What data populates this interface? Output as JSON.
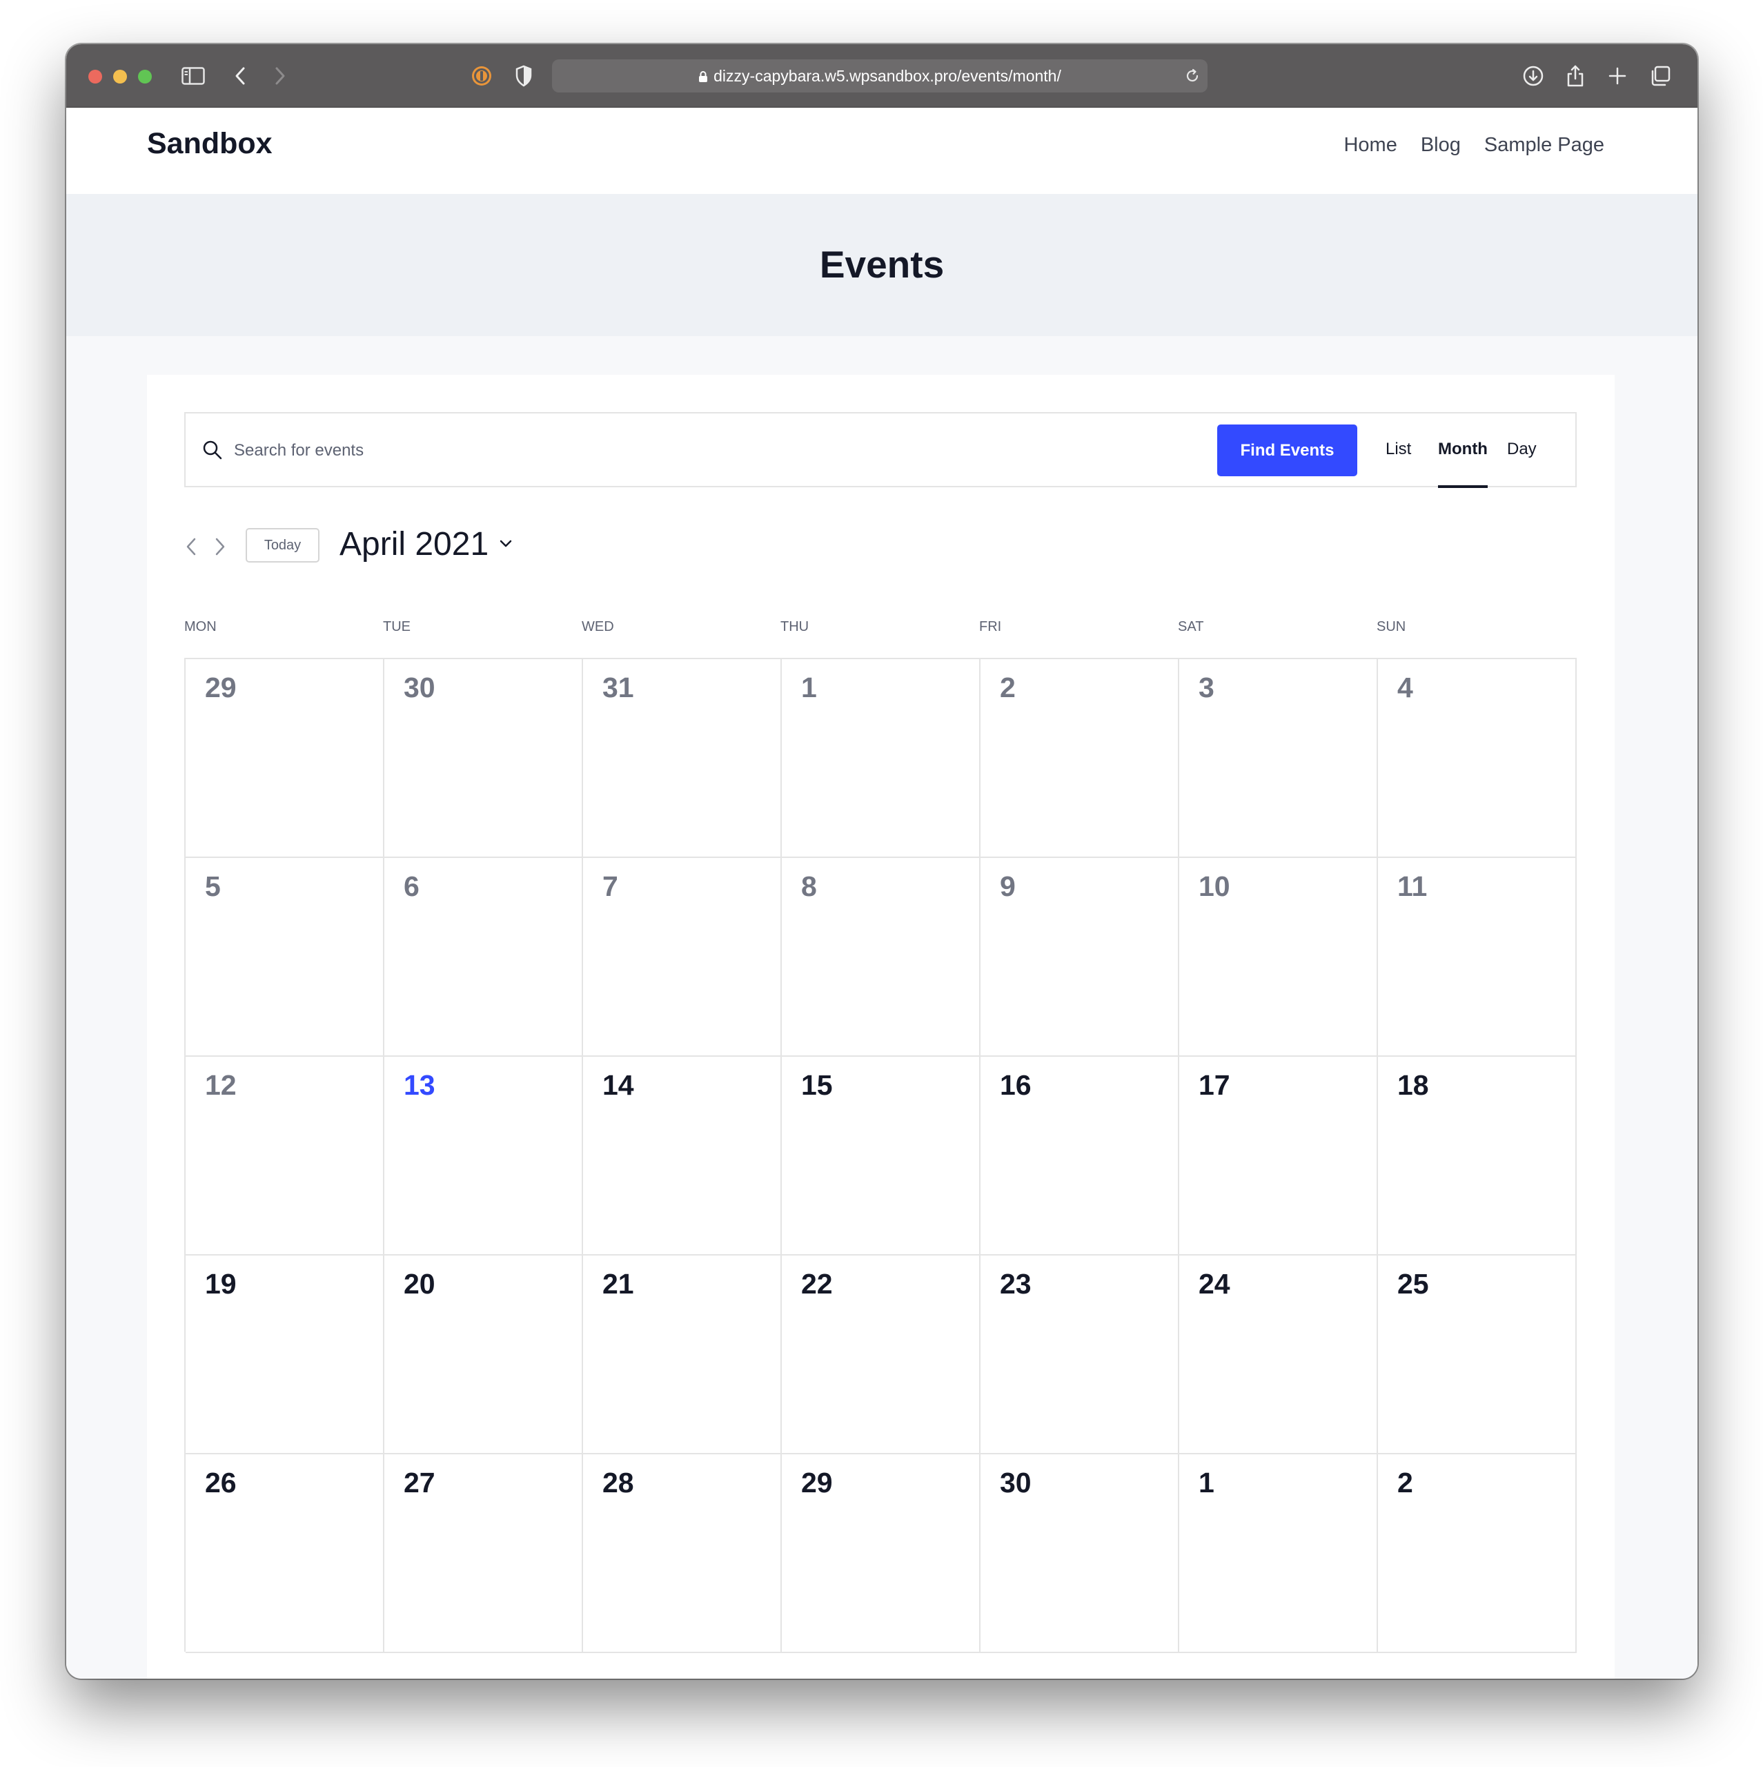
{
  "browser": {
    "url": "dizzy-capybara.w5.wpsandbox.pro/events/month/",
    "traffic_lights": [
      "#ec6a5e",
      "#f4bf4f",
      "#61c554"
    ]
  },
  "site": {
    "title": "Sandbox",
    "nav": [
      "Home",
      "Blog",
      "Sample Page"
    ]
  },
  "page": {
    "heading": "Events"
  },
  "search": {
    "placeholder": "Search for events",
    "button_label": "Find Events"
  },
  "views": {
    "list": "List",
    "month": "Month",
    "day": "Day",
    "active": "Month"
  },
  "calendar": {
    "today_label": "Today",
    "month_label": "April 2021",
    "weekdays": [
      "MON",
      "TUE",
      "WED",
      "THU",
      "FRI",
      "SAT",
      "SUN"
    ],
    "weeks": [
      [
        {
          "d": "29",
          "s": "past"
        },
        {
          "d": "30",
          "s": "past"
        },
        {
          "d": "31",
          "s": "past"
        },
        {
          "d": "1",
          "s": "past"
        },
        {
          "d": "2",
          "s": "past"
        },
        {
          "d": "3",
          "s": "past"
        },
        {
          "d": "4",
          "s": "past"
        }
      ],
      [
        {
          "d": "5",
          "s": "past"
        },
        {
          "d": "6",
          "s": "past"
        },
        {
          "d": "7",
          "s": "past"
        },
        {
          "d": "8",
          "s": "past"
        },
        {
          "d": "9",
          "s": "past"
        },
        {
          "d": "10",
          "s": "past"
        },
        {
          "d": "11",
          "s": "past"
        }
      ],
      [
        {
          "d": "12",
          "s": "past"
        },
        {
          "d": "13",
          "s": "today"
        },
        {
          "d": "14",
          "s": "current"
        },
        {
          "d": "15",
          "s": "current"
        },
        {
          "d": "16",
          "s": "current"
        },
        {
          "d": "17",
          "s": "current"
        },
        {
          "d": "18",
          "s": "current"
        }
      ],
      [
        {
          "d": "19",
          "s": "current"
        },
        {
          "d": "20",
          "s": "current"
        },
        {
          "d": "21",
          "s": "current"
        },
        {
          "d": "22",
          "s": "current"
        },
        {
          "d": "23",
          "s": "current"
        },
        {
          "d": "24",
          "s": "current"
        },
        {
          "d": "25",
          "s": "current"
        }
      ],
      [
        {
          "d": "26",
          "s": "current"
        },
        {
          "d": "27",
          "s": "current"
        },
        {
          "d": "28",
          "s": "current"
        },
        {
          "d": "29",
          "s": "current"
        },
        {
          "d": "30",
          "s": "current"
        },
        {
          "d": "1",
          "s": "current"
        },
        {
          "d": "2",
          "s": "current"
        }
      ]
    ]
  },
  "colors": {
    "accent": "#334aff",
    "text_dark": "#141827",
    "text_muted": "#727683"
  }
}
